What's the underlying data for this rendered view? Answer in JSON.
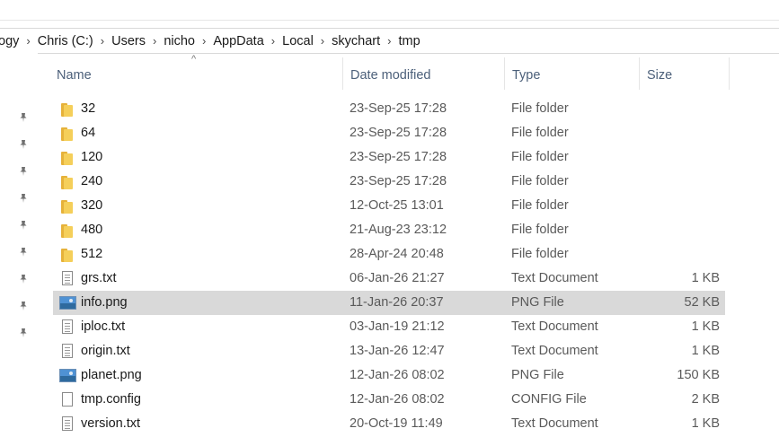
{
  "breadcrumb": [
    "ogy",
    "Chris (C:)",
    "Users",
    "nicho",
    "AppData",
    "Local",
    "skychart",
    "tmp"
  ],
  "breadcrumb_separator": "›",
  "columns": {
    "name": "Name",
    "date": "Date modified",
    "type": "Type",
    "size": "Size"
  },
  "sort_indicator": "^",
  "pins": [
    "pin",
    "pin",
    "pin",
    "pin",
    "pin",
    "pin",
    "pin",
    "pin",
    "pin"
  ],
  "files": [
    {
      "name": "32",
      "date": "23-Sep-25 17:28",
      "type": "File folder",
      "size": "",
      "icon": "folder"
    },
    {
      "name": "64",
      "date": "23-Sep-25 17:28",
      "type": "File folder",
      "size": "",
      "icon": "folder"
    },
    {
      "name": "120",
      "date": "23-Sep-25 17:28",
      "type": "File folder",
      "size": "",
      "icon": "folder"
    },
    {
      "name": "240",
      "date": "23-Sep-25 17:28",
      "type": "File folder",
      "size": "",
      "icon": "folder"
    },
    {
      "name": "320",
      "date": "12-Oct-25 13:01",
      "type": "File folder",
      "size": "",
      "icon": "folder"
    },
    {
      "name": "480",
      "date": "21-Aug-23 23:12",
      "type": "File folder",
      "size": "",
      "icon": "folder"
    },
    {
      "name": "512",
      "date": "28-Apr-24 20:48",
      "type": "File folder",
      "size": "",
      "icon": "folder"
    },
    {
      "name": "grs.txt",
      "date": "06-Jan-26 21:27",
      "type": "Text Document",
      "size": "1 KB",
      "icon": "text"
    },
    {
      "name": "info.png",
      "date": "11-Jan-26 20:37",
      "type": "PNG File",
      "size": "52 KB",
      "icon": "image",
      "selected": true
    },
    {
      "name": "iploc.txt",
      "date": "03-Jan-19 21:12",
      "type": "Text Document",
      "size": "1 KB",
      "icon": "text"
    },
    {
      "name": "origin.txt",
      "date": "13-Jan-26 12:47",
      "type": "Text Document",
      "size": "1 KB",
      "icon": "text"
    },
    {
      "name": "planet.png",
      "date": "12-Jan-26 08:02",
      "type": "PNG File",
      "size": "150 KB",
      "icon": "image"
    },
    {
      "name": "tmp.config",
      "date": "12-Jan-26 08:02",
      "type": "CONFIG File",
      "size": "2 KB",
      "icon": "blank"
    },
    {
      "name": "version.txt",
      "date": "20-Oct-19 11:49",
      "type": "Text Document",
      "size": "1 KB",
      "icon": "text"
    }
  ]
}
